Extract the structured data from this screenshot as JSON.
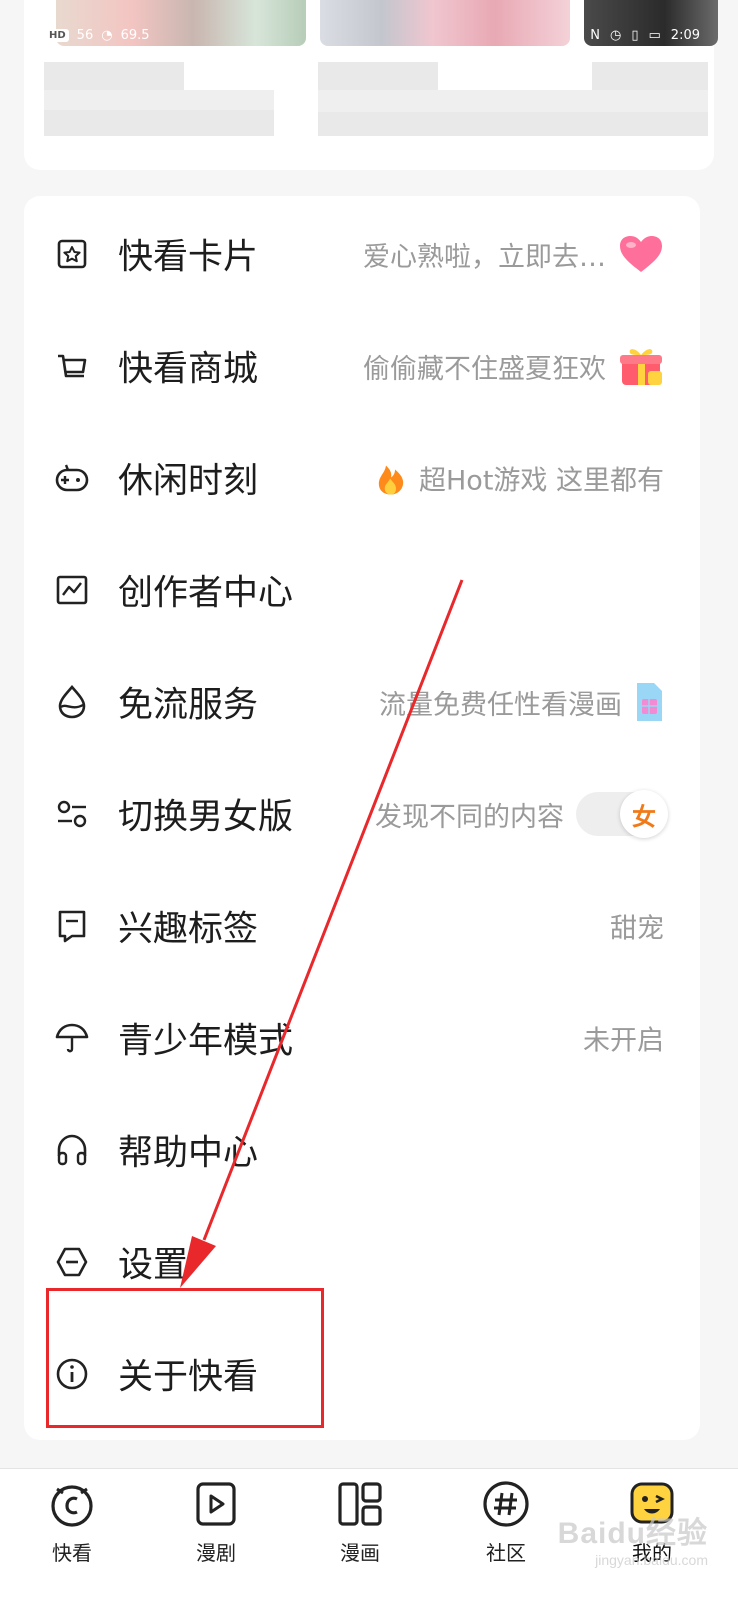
{
  "status_bar": {
    "network": "56",
    "speed": "69.5",
    "time": "2:09"
  },
  "menu": [
    {
      "icon": "card-icon",
      "label": "快看卡片",
      "desc": "爱心熟啦，立即去…",
      "extra": "heart"
    },
    {
      "icon": "cart-icon",
      "label": "快看商城",
      "desc": "偷偷藏不住盛夏狂欢",
      "extra": "gift"
    },
    {
      "icon": "gamepad-icon",
      "label": "休闲时刻",
      "desc": "超Hot游戏 这里都有",
      "extra": "fire"
    },
    {
      "icon": "chart-icon",
      "label": "创作者中心",
      "desc": "",
      "extra": ""
    },
    {
      "icon": "drop-icon",
      "label": "免流服务",
      "desc": "流量免费任性看漫画",
      "extra": "sim"
    },
    {
      "icon": "switch-icon",
      "label": "切换男女版",
      "desc": "发现不同的内容",
      "extra": "toggle",
      "toggle_label": "女"
    },
    {
      "icon": "tag-icon",
      "label": "兴趣标签",
      "desc": "甜宠",
      "extra": ""
    },
    {
      "icon": "umbrella-icon",
      "label": "青少年模式",
      "desc": "未开启",
      "extra": ""
    },
    {
      "icon": "headphones-icon",
      "label": "帮助中心",
      "desc": "",
      "extra": ""
    },
    {
      "icon": "settings-icon",
      "label": "设置",
      "desc": "",
      "extra": ""
    },
    {
      "icon": "info-icon",
      "label": "关于快看",
      "desc": "",
      "extra": ""
    }
  ],
  "tabs": [
    {
      "icon": "kuaikan-icon",
      "label": "快看"
    },
    {
      "icon": "play-icon",
      "label": "漫剧"
    },
    {
      "icon": "comic-icon",
      "label": "漫画"
    },
    {
      "icon": "hashtag-icon",
      "label": "社区"
    },
    {
      "icon": "avatar-icon",
      "label": "我的"
    }
  ],
  "watermark": {
    "text": "Baidu经验",
    "sub": "jingyan.baidu.com"
  },
  "colors": {
    "annotation": "#e8282b",
    "accent": "#f07a1a",
    "heart": "#ff6f9b"
  }
}
